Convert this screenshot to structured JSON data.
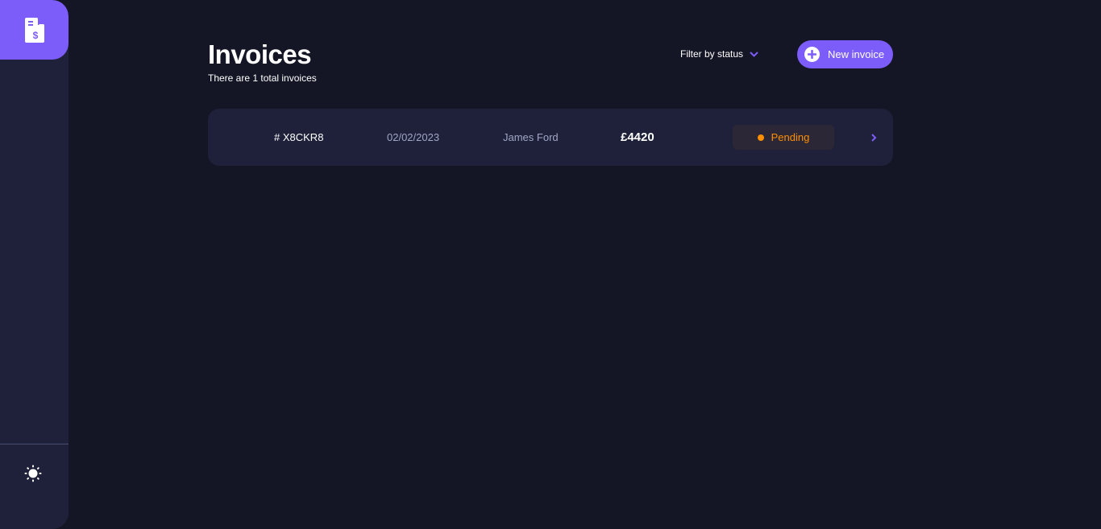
{
  "header": {
    "title": "Invoices",
    "subtitle": "There are 1 total invoices",
    "filter_label": "Filter by status",
    "new_invoice_label": "New invoice"
  },
  "invoices": [
    {
      "id": "# X8CKR8",
      "date": "02/02/2023",
      "client": "James Ford",
      "amount": "£4420",
      "status": "Pending"
    }
  ],
  "icons": {
    "logo": "invoice-document-icon",
    "theme_toggle": "sun-icon",
    "filter": "chevron-down-icon",
    "new_invoice": "plus-icon",
    "row": "chevron-right-icon"
  },
  "colors": {
    "background": "#141625",
    "sidebar": "#1e2139",
    "accent": "#7c5dfa",
    "card": "#1e2139",
    "pending": "#ff8f00",
    "muted_text": "#a2a6c4"
  }
}
